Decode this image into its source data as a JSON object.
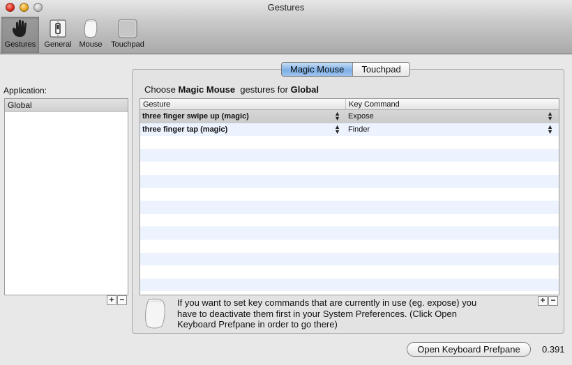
{
  "window": {
    "title": "Gestures"
  },
  "toolbar": [
    {
      "label": "Gestures",
      "icon": "hand-gestures-icon",
      "selected": true
    },
    {
      "label": "General",
      "icon": "light-switch-icon",
      "selected": false
    },
    {
      "label": "Mouse",
      "icon": "magic-mouse-icon",
      "selected": false
    },
    {
      "label": "Touchpad",
      "icon": "touchpad-icon",
      "selected": false
    }
  ],
  "applications": {
    "label": "Application:",
    "items": [
      "Global"
    ],
    "add_label": "+",
    "remove_label": "−"
  },
  "device_tabs": [
    {
      "label": "Magic Mouse",
      "active": true
    },
    {
      "label": "Touchpad",
      "active": false
    }
  ],
  "choose": {
    "prefix": "Choose",
    "device": "Magic Mouse",
    "middle": "gestures for",
    "app": "Global"
  },
  "table": {
    "headers": [
      "Gesture",
      "Key Command"
    ],
    "rows": [
      {
        "gesture": "three finger swipe up (magic)",
        "command": "Expose"
      },
      {
        "gesture": "three finger tap (magic)",
        "command": "Finder"
      }
    ],
    "add_label": "+",
    "remove_label": "−"
  },
  "note": "If you want to set key commands that are currently in use (eg. expose) you have to deactivate them first in your System Preferences. (Click Open Keyboard Prefpane in order to go there)",
  "open_prefpane_button": "Open Keyboard Prefpane",
  "version": "0.391",
  "colors": {
    "tab_active": "#7fb0e6",
    "row_alt": "#ecf3fe",
    "selected_row": "#cacaca"
  }
}
